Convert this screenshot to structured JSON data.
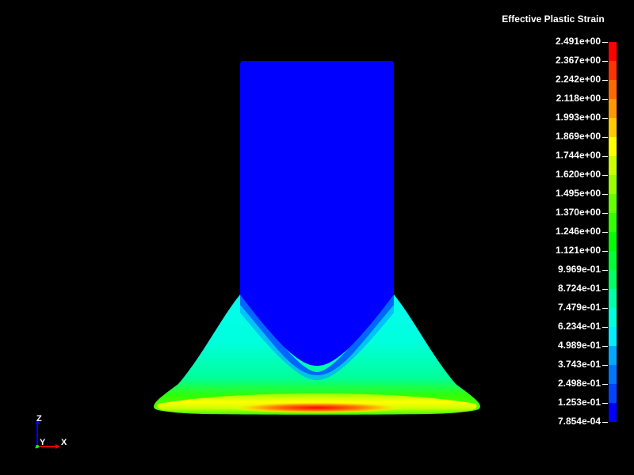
{
  "legend": {
    "title": "Effective Plastic Strain",
    "labels": [
      "2.491e+00",
      "2.367e+00",
      "2.242e+00",
      "2.118e+00",
      "1.993e+00",
      "1.869e+00",
      "1.744e+00",
      "1.620e+00",
      "1.495e+00",
      "1.370e+00",
      "1.246e+00",
      "1.121e+00",
      "9.969e-01",
      "8.724e-01",
      "7.479e-01",
      "6.234e-01",
      "4.989e-01",
      "3.743e-01",
      "2.498e-01",
      "1.253e-01",
      "7.854e-04"
    ],
    "colors": [
      "#ff0000",
      "#ff3300",
      "#ff6a00",
      "#ff9900",
      "#ffcc00",
      "#ffff00",
      "#ccff00",
      "#99ff00",
      "#66ff00",
      "#33ff00",
      "#00ff00",
      "#00ff33",
      "#00ff66",
      "#00ffaa",
      "#00ffdd",
      "#00eeff",
      "#00aaff",
      "#0077ff",
      "#0044ff",
      "#0000ff"
    ]
  },
  "model": {
    "body_color": "#0000ff"
  },
  "triad": {
    "z_label": "Z",
    "y_label": "Y",
    "x_label": "X",
    "z_color": "#0000ff",
    "y_color": "#00ff00",
    "x_color": "#ff0000"
  }
}
